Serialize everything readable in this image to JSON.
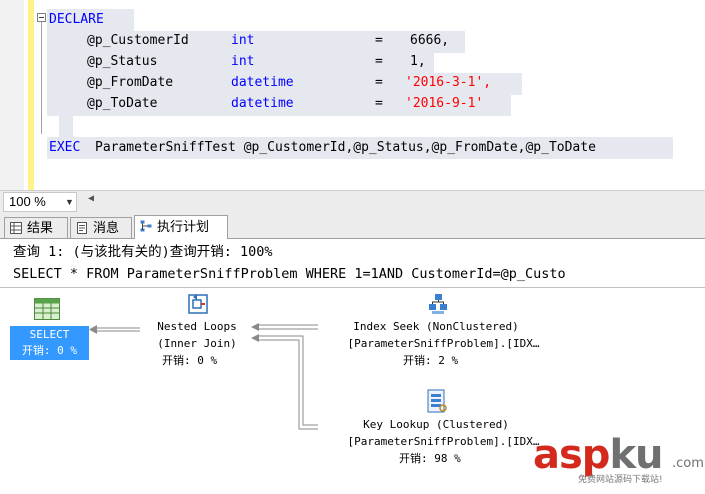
{
  "editor": {
    "lines": {
      "l1": {
        "kw": "DECLARE"
      },
      "l2": {
        "param": "@p_CustomerId",
        "type": "int",
        "eq": "=",
        "value": "6666,"
      },
      "l3": {
        "param": "@p_Status",
        "type": "int",
        "eq": "=",
        "value": "1,"
      },
      "l4": {
        "param": "@p_FromDate",
        "type": "datetime",
        "eq": "=",
        "value": "'2016-3-1',"
      },
      "l5": {
        "param": "@p_ToDate",
        "type": "datetime",
        "eq": "=",
        "value": "'2016-9-1'"
      },
      "l6": {
        "kw": "EXEC",
        "rest": "ParameterSniffTest @p_CustomerId,@p_Status,@p_FromDate,@p_ToDate"
      }
    }
  },
  "zoom": {
    "value": "100 %"
  },
  "tabs": {
    "results": "结果",
    "messages": "消息",
    "plan": "执行计划"
  },
  "plan": {
    "query_header": "查询 1: (与该批有关的)查询开销: 100%",
    "query_sql": "SELECT * FROM ParameterSniffProblem WHERE 1=1AND CustomerId=@p_Custo",
    "nodes": {
      "select": {
        "name": "SELECT",
        "cost": "开销: 0 %"
      },
      "nested_loops": {
        "name": "Nested Loops",
        "sub": "(Inner Join)",
        "cost": "开销: 0 %"
      },
      "index_seek": {
        "name": "Index Seek (NonClustered)",
        "sub": "[ParameterSniffProblem].[IDX…",
        "cost": "开销: 2 %"
      },
      "key_lookup": {
        "name": "Key Lookup (Clustered)",
        "sub": "[ParameterSniffProblem].[IDX…",
        "cost": "开销: 98 %"
      }
    }
  },
  "watermark": {
    "brand_asp": "asp",
    "brand_ku": "ku",
    "tld": ".com",
    "slogan": "免费网站源码下载站!"
  }
}
